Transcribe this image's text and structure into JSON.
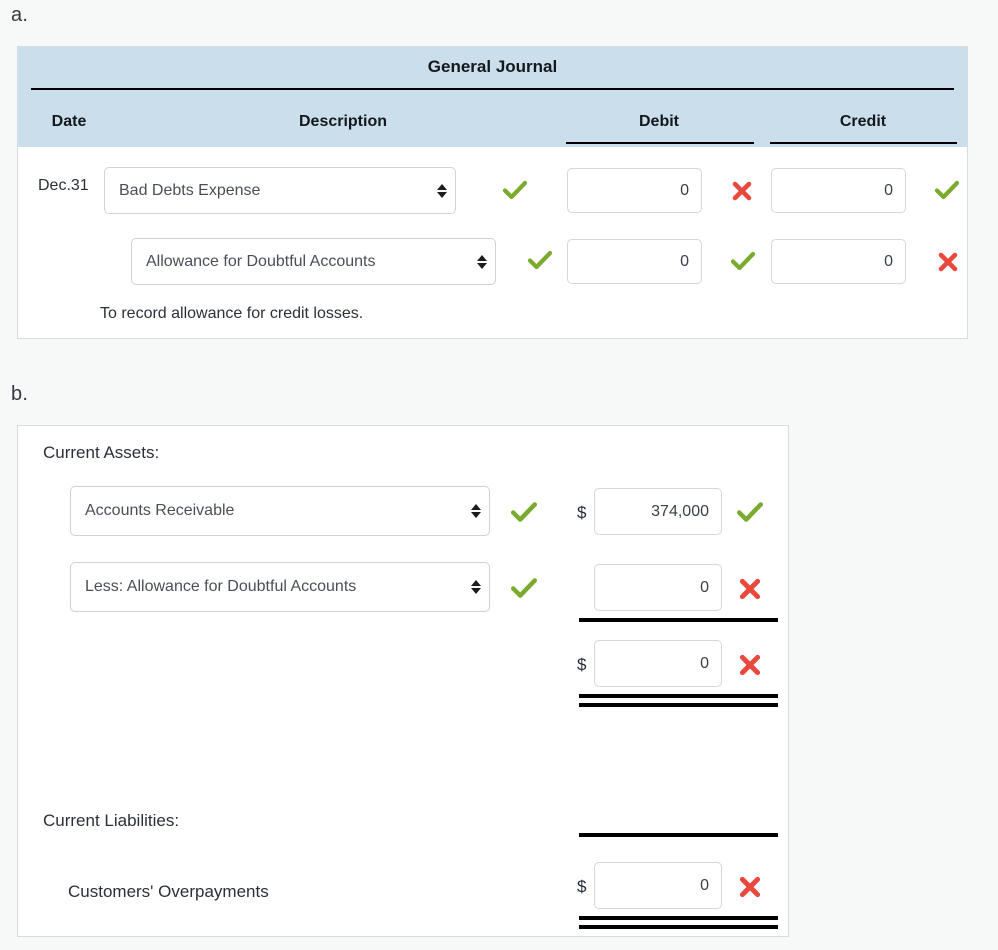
{
  "page": {
    "background": "#f7f8f8",
    "accent_ok": "#7aab2e",
    "accent_bad": "#e8493c",
    "header_blue": "#cadfeb"
  },
  "part_a": {
    "label": "a.",
    "journal": {
      "title": "General Journal",
      "columns": {
        "date": "Date",
        "description": "Description",
        "debit": "Debit",
        "credit": "Credit"
      },
      "rows": [
        {
          "date": "Dec.31",
          "account": "Bad Debts Expense",
          "account_status": "correct",
          "debit": "0",
          "debit_status": "incorrect",
          "credit": "0",
          "credit_status": "correct"
        },
        {
          "date": "",
          "account": "Allowance for Doubtful Accounts",
          "account_status": "correct",
          "debit": "0",
          "debit_status": "correct",
          "credit": "0",
          "credit_status": "incorrect"
        }
      ],
      "memo": "To record allowance for credit losses."
    }
  },
  "part_b": {
    "label": "b.",
    "sections": [
      {
        "heading": "Current Assets:"
      },
      {
        "heading": "Current Liabilities:"
      }
    ],
    "assets": {
      "heading": "Current Assets:",
      "lines": [
        {
          "account": "Accounts Receivable",
          "account_status": "correct",
          "currency": "$",
          "amount": "374,000",
          "amount_status": "correct"
        },
        {
          "account": "Less: Allowance for Doubtful Accounts",
          "account_status": "correct",
          "currency": "",
          "amount": "0",
          "amount_status": "incorrect"
        }
      ],
      "total": {
        "currency": "$",
        "amount": "0",
        "amount_status": "incorrect"
      }
    },
    "liabilities": {
      "heading": "Current Liabilities:",
      "lines": [
        {
          "account": "Customers' Overpayments",
          "currency": "$",
          "amount": "0",
          "amount_status": "incorrect"
        }
      ]
    }
  }
}
